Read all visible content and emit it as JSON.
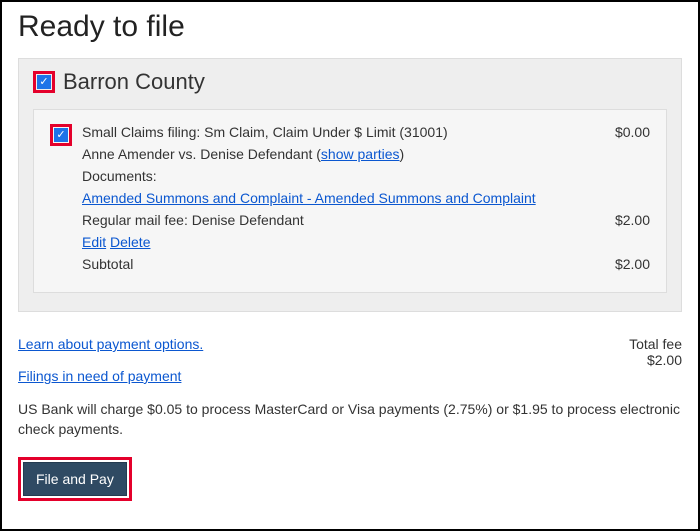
{
  "title": "Ready to file",
  "county": {
    "name": "Barron County",
    "checked": true
  },
  "filing": {
    "checked": true,
    "description": "Small Claims filing: Sm Claim, Claim Under $ Limit (31001)",
    "description_amount": "$0.00",
    "parties_text": "Anne Amender vs. Denise Defendant  (",
    "show_parties_label": "show parties",
    "parties_close": ")",
    "documents_label": "Documents:",
    "document_link": "Amended Summons and Complaint - Amended Summons and Complaint",
    "mail_fee_label": "Regular mail fee: Denise Defendant",
    "mail_fee_amount": "$2.00",
    "edit_label": "Edit",
    "delete_label": "Delete",
    "subtotal_label": "Subtotal",
    "subtotal_amount": "$2.00"
  },
  "links": {
    "payment_options": "Learn about payment options.",
    "filings_need_payment": "Filings in need of payment"
  },
  "totals": {
    "label": "Total fee",
    "amount": "$2.00"
  },
  "disclaimer": "US Bank will charge $0.05 to process MasterCard or Visa payments (2.75%) or $1.95 to process electronic check payments.",
  "button": {
    "file_and_pay": "File and Pay"
  }
}
